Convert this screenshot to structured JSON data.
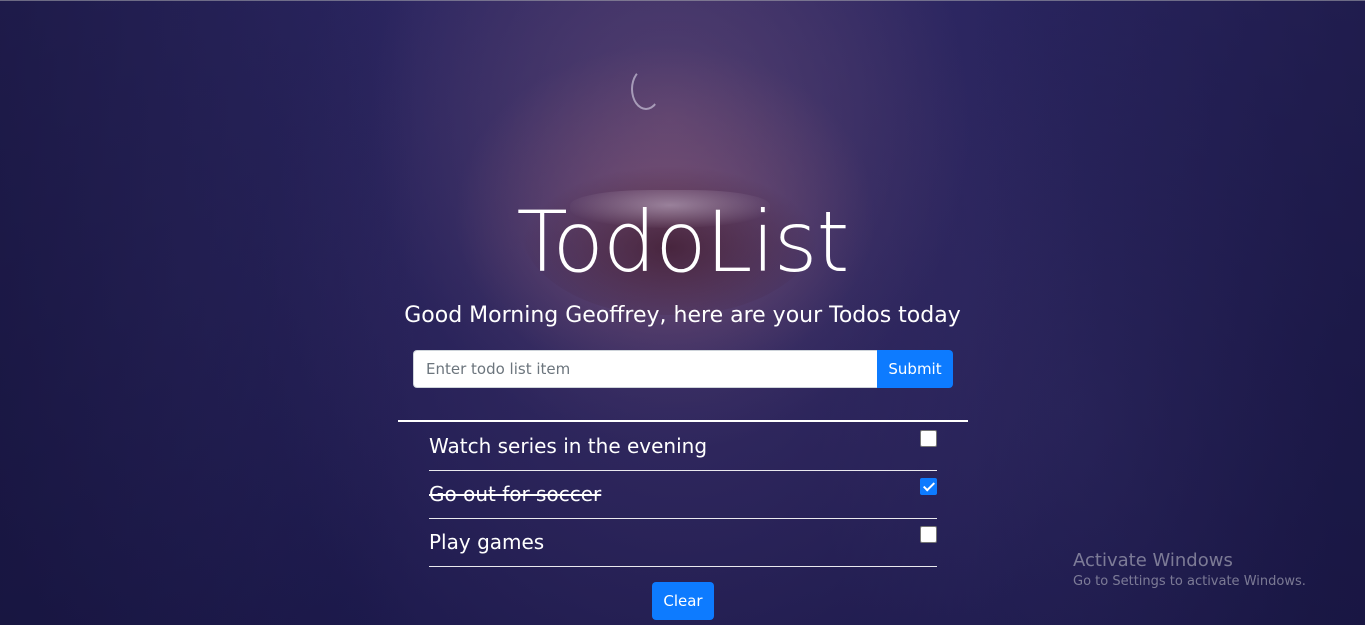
{
  "app": {
    "title": "TodoList",
    "greeting": "Good Morning Geoffrey, here are your Todos today"
  },
  "form": {
    "input_placeholder": "Enter todo list item",
    "input_value": "",
    "submit_label": "Submit"
  },
  "todos": [
    {
      "text": "Watch series in the evening",
      "completed": false
    },
    {
      "text": "Go out for soccer",
      "completed": true
    },
    {
      "text": "Play games",
      "completed": false
    }
  ],
  "clear_label": "Clear",
  "watermark": {
    "title": "Activate Windows",
    "subtitle": "Go to Settings to activate Windows."
  },
  "colors": {
    "accent": "#0d7bff",
    "background": "#211d52",
    "text": "#ffffff"
  }
}
